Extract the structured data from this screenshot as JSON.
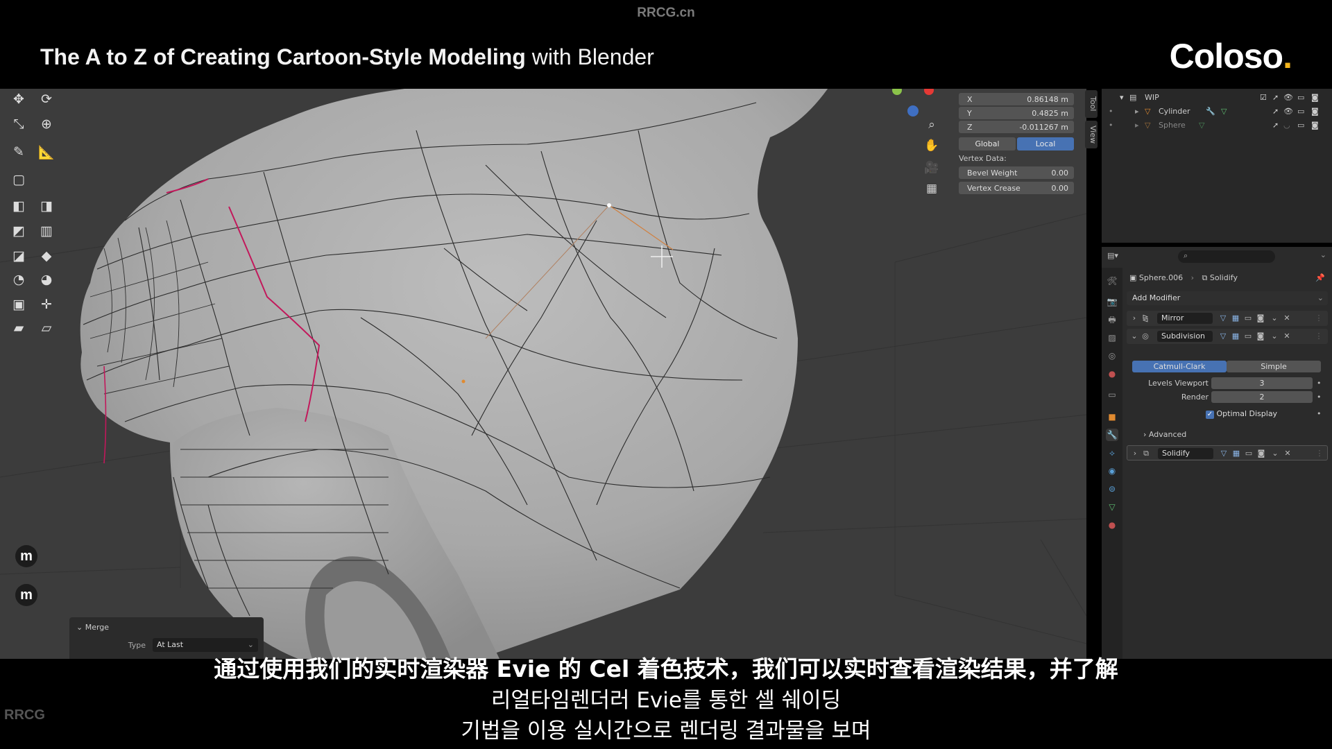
{
  "watermark": "RRCG.cn",
  "header": {
    "title_bold": "The A to Z of Creating Cartoon-Style Modeling",
    "title_rest": " with Blender",
    "logo_text": "Coloso",
    "logo_dot": "."
  },
  "transform_panel": {
    "x_label": "X",
    "x_value": "0.86148 m",
    "y_label": "Y",
    "y_value": "0.4825 m",
    "z_label": "Z",
    "z_value": "-0.011267 m",
    "global_label": "Global",
    "local_label": "Local",
    "vertex_data_label": "Vertex Data:",
    "bevel_weight_label": "Bevel Weight",
    "bevel_weight_value": "0.00",
    "vertex_crease_label": "Vertex Crease",
    "vertex_crease_value": "0.00"
  },
  "side_tabs": {
    "tool": "Tool",
    "view": "View"
  },
  "outliner": {
    "collection": "WIP",
    "items": [
      {
        "name": "Cylinder"
      },
      {
        "name": "Sphere"
      }
    ]
  },
  "properties": {
    "object_name": "Sphere.006",
    "modifier_name": "Solidify",
    "add_modifier_label": "Add Modifier",
    "modifiers": [
      {
        "name": "Mirror"
      },
      {
        "name": "Subdivision"
      },
      {
        "name": "Solidify"
      }
    ],
    "subdivision": {
      "catmull_label": "Catmull-Clark",
      "simple_label": "Simple",
      "levels_viewport_label": "Levels Viewport",
      "levels_viewport_value": "3",
      "render_label": "Render",
      "render_value": "2",
      "optimal_display_label": "Optimal Display",
      "optimal_display_checked": true,
      "advanced_label": "Advanced"
    }
  },
  "merge_panel": {
    "title": "Merge",
    "type_label": "Type",
    "type_value": "At Last"
  },
  "tool_buttons": {
    "m1": "m",
    "m2": "m"
  },
  "subtitles": {
    "zh": "通过使用我们的实时渲染器 Evie 的 Cel 着色技术，我们可以实时查看渲染结果，并了解",
    "ko_line1": "리얼타임렌더러 Evie를 통한 셀 쉐이딩",
    "ko_line2": "기법을 이용 실시간으로 렌더링 결과물을 보며"
  },
  "badge": "RRCG",
  "colors": {
    "accent_blue": "#4772b3",
    "selected_edge": "#c2185b",
    "active_vertex": "#f0a040"
  }
}
